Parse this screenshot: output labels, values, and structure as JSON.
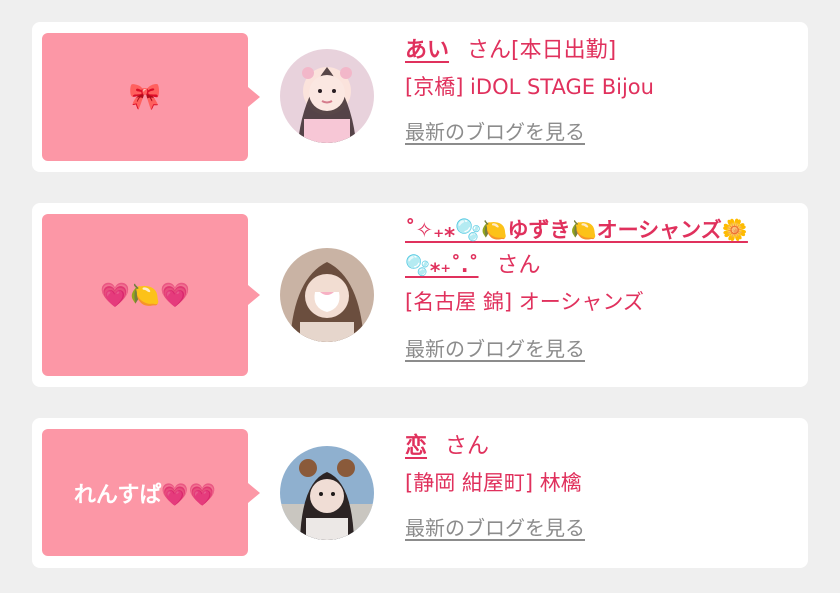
{
  "cards": [
    {
      "bubble_text": "🎀",
      "name": "あい",
      "san": "さん[本日出勤]",
      "shop": "[京橋] iDOL STAGE Bijou",
      "blog_link": "最新のブログを見る"
    },
    {
      "bubble_text": "💗🍋💗",
      "name_line1": "˚✧₊⁎🫧🍋ゆずき🍋オーシャンズ🌼",
      "name_line2": "🫧⁎₊˚.˚",
      "san": "さん",
      "shop": "[名古屋 錦] オーシャンズ",
      "blog_link": "最新のブログを見る"
    },
    {
      "bubble_text": "れんすぱ💗💗",
      "name": "恋",
      "san": "さん",
      "shop": "[静岡 紺屋町] 林檎",
      "blog_link": "最新のブログを見る"
    }
  ],
  "colors": {
    "accent": "#e0315d",
    "bubble": "#fc97a6",
    "link_gray": "#8c8c8c",
    "background": "#efefef"
  }
}
